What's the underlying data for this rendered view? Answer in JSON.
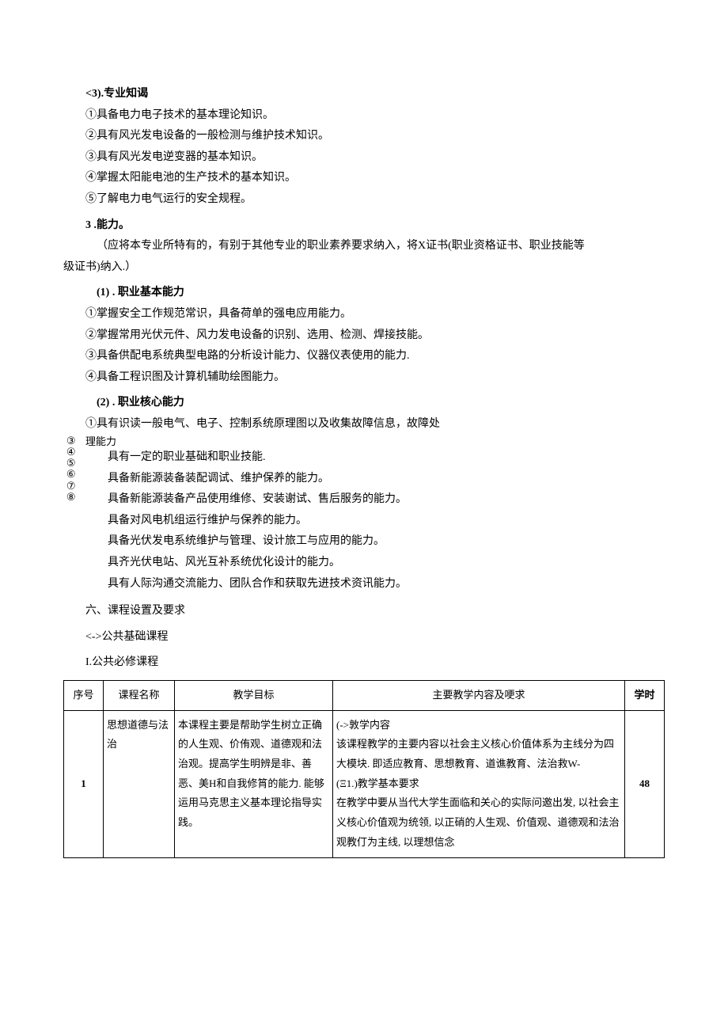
{
  "sec3": {
    "title": "<3).专业知谒",
    "items": [
      "①具备电力电子技术的基本理论知识。",
      "②具有风光发电设备的一般检测与维护技术知识。",
      "③具有风光发电逆变器的基本知识。",
      "④掌握太阳能电池的生产技术的基本知识。",
      "⑤了解电力电气运行的安全规程。"
    ]
  },
  "ability": {
    "title": "3 .能力。",
    "note_line1": "（应将本专业所特有的，有别于其他专业的职业素养要求纳入，将X证书(职业资格证书、职业技能等",
    "note_line2": "级证书)纳入.）",
    "sub1": {
      "title": "(1)    . 职业基本能力",
      "items": [
        "①掌握安全工作规范常识，具备荷单的强电应用能力。",
        "②掌握常用光伏元件、风力发电设备的识别、选用、检测、焊接技能。",
        "③具备供配电系统典型电路的分析设计能力、仪器仪表使用的能力.",
        "④具备工程识图及计算机辅助绘图能力。"
      ]
    },
    "sub2": {
      "title": "(2)    . 职业核心能力",
      "lead": "①具有识读一般电气、电子、控制系统原理图以及收集故障信息，故障处",
      "overlap_top": "理能力",
      "glyphs": [
        "③",
        "④",
        "⑤",
        "⑥",
        "⑦",
        "⑧"
      ],
      "lines": [
        "具有一定的职业基础和职业技能.",
        "具备新能源装备装配调试、维护保养的能力。",
        "具备新能源装备产品使用维修、安装谢试、售后服务的能力。",
        "具备对风电机组运行维护与保养的能力。",
        "具备光伏发电系统维护与管理、设计旅工与应用的能力。",
        "具齐光伏电站、风光互补系统优化设计的能力。",
        "具有人际沟通交流能力、团队合作和获取先进技术资讯能力。"
      ]
    }
  },
  "heading6": "六、课程设置及要求",
  "heading_sub": "<->公共基础课程",
  "heading_req": "I.公共必修课程",
  "table": {
    "headers": [
      "序号",
      "课程名称",
      "教学目标",
      "主要教学内容及哽求",
      "学时"
    ],
    "rows": [
      {
        "seq": "1",
        "name": "思想道德与法治",
        "goal": "本课程主要是帮助学生树立正确的人生观、价侑观、道德观和法治观。提高学生明辨是非、善恶、美H和自我修筲的能力. 能够运用马克思主义基本理论指导实践。",
        "content": "        (->敦学内容\n    该课程教学的主要内容以社会主义核心价值体系为主线分为四大模块. 即适应教育、思想教育、道谯教育、法治救W-\n        (Ξ1.)教学基本要求\n在教学中要从当代大学生面临和关心的实际问邀出发, 以社会主义核心价值观为统领, 以正硝的人生观、价值观、道德观和法治观教仃为主线, 以理想信念",
        "hours": "48"
      }
    ]
  }
}
